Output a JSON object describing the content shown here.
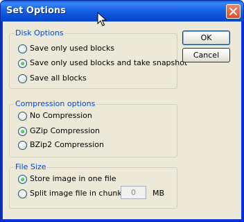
{
  "window": {
    "title": "Set Options"
  },
  "buttons": {
    "ok": "OK",
    "cancel": "Cancel"
  },
  "disk_options": {
    "label": "Disk Options",
    "options": [
      {
        "label": "Save only used blocks",
        "checked": false
      },
      {
        "label": "Save only used blocks and take snapshot",
        "checked": true
      },
      {
        "label": "Save all blocks",
        "checked": false
      }
    ]
  },
  "compression": {
    "label": "Compression options",
    "options": [
      {
        "label": "No Compression",
        "checked": false
      },
      {
        "label": "GZip Compression",
        "checked": true
      },
      {
        "label": "BZip2 Compression",
        "checked": false
      }
    ]
  },
  "file_size": {
    "label": "File Size",
    "options": [
      {
        "label": "Store image in one file",
        "checked": true
      },
      {
        "label": "Split image file in chunks",
        "checked": false
      }
    ],
    "chunk_value": "0",
    "chunk_unit": "MB"
  },
  "colors": {
    "title_bar": "#0a4fd6",
    "client_bg": "#ece9d8",
    "group_label": "#0046d5"
  },
  "icons": {
    "close": "close-icon",
    "cursor": "mouse-cursor-icon"
  }
}
